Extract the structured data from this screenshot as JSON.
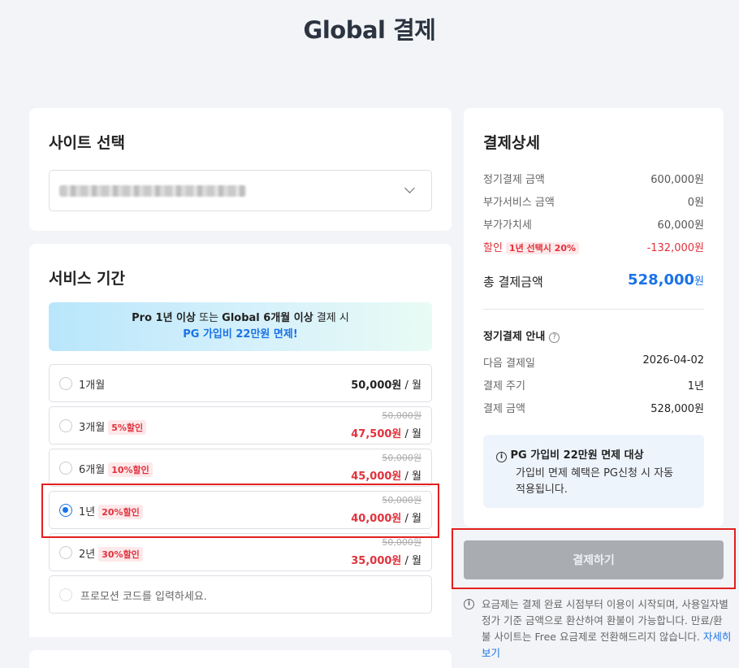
{
  "page_title": "Global 결제",
  "site_section": {
    "title": "사이트 선택",
    "selected_value": ""
  },
  "period_section": {
    "title": "서비스 기간",
    "promo": {
      "line1_a": "Pro 1년 이상",
      "line1_b": " 또는 ",
      "line1_c": "Global 6개월 이상",
      "line1_d": " 결제 시",
      "line2": "PG 가입비 22만원 면제!"
    },
    "options": [
      {
        "label": "1개월",
        "badge": "",
        "original": "",
        "price": "50,000원",
        "unit": " / 월",
        "selected": false
      },
      {
        "label": "3개월",
        "badge": "5%할인",
        "original": "50,000원",
        "price": "47,500원",
        "unit": " / 월",
        "selected": false
      },
      {
        "label": "6개월",
        "badge": "10%할인",
        "original": "50,000원",
        "price": "45,000원",
        "unit": " / 월",
        "selected": false
      },
      {
        "label": "1년",
        "badge": "20%할인",
        "original": "50,000원",
        "price": "40,000원",
        "unit": " / 월",
        "selected": true
      },
      {
        "label": "2년",
        "badge": "30%할인",
        "original": "50,000원",
        "price": "35,000원",
        "unit": " / 월",
        "selected": false
      }
    ],
    "coupon_placeholder": "프로모션 코드를 입력하세요."
  },
  "detail": {
    "title": "결제상세",
    "rows": [
      {
        "label": "정기결제 금액",
        "value": "600,000원"
      },
      {
        "label": "부가서비스 금액",
        "value": "0원"
      },
      {
        "label": "부가가치세",
        "value": "60,000원"
      }
    ],
    "discount": {
      "label": "할인",
      "badge": "1년 선택시 20%",
      "value": "-132,000원"
    },
    "total": {
      "label": "총 결제금액",
      "value": "528,000",
      "unit": "원"
    },
    "recurring": {
      "title": "정기결제 안내",
      "rows": [
        {
          "label": "다음 결제일",
          "value": "2026-04-02"
        },
        {
          "label": "결제 주기",
          "value": "1년"
        },
        {
          "label": "결제 금액",
          "value": "528,000원"
        }
      ]
    },
    "notice": {
      "title": "PG 가입비 22만원 면제 대상",
      "body": "가입비 면제 혜택은 PG신청 시 자동 적용됩니다."
    }
  },
  "pay_button": "결제하기",
  "footnote": {
    "text": "요금제는 결제 완료 시점부터 이용이 시작되며, 사용일자별 정가 기준 금액으로 환산하여 환불이 가능합니다. 만료/환불 사이트는 Free 요금제로 전환해드리지 않습니다. ",
    "link": "자세히 보기"
  },
  "colors": {
    "accent": "#1a73e8",
    "discount": "#e0323c",
    "highlight": "#e31f1f"
  }
}
